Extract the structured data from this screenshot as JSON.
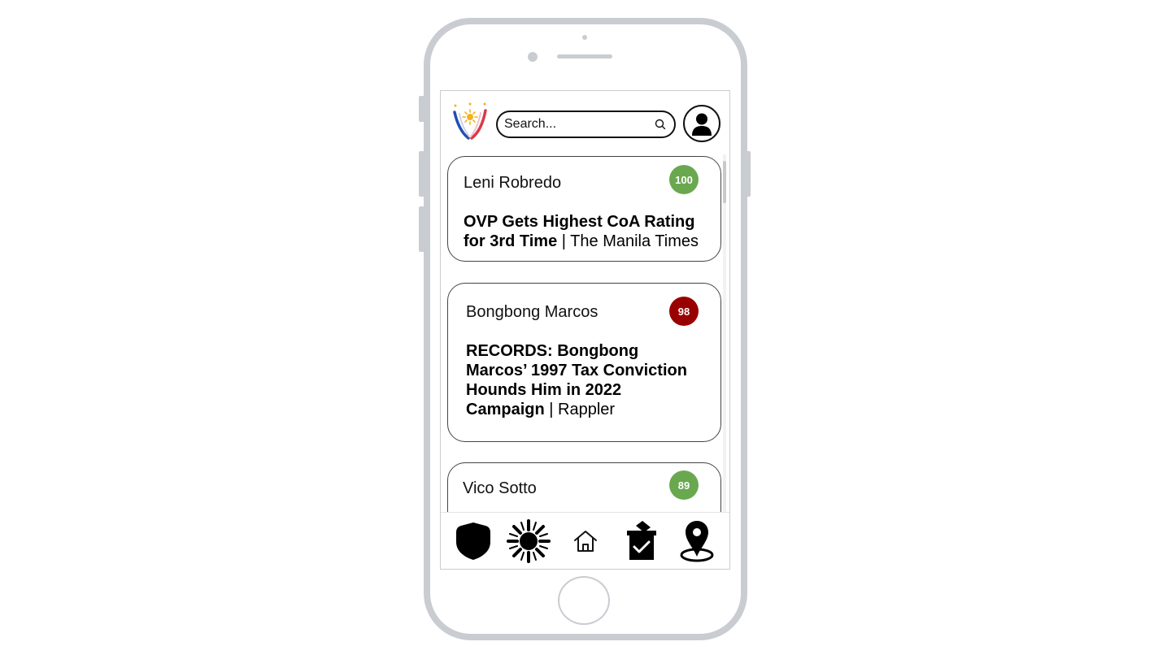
{
  "search": {
    "placeholder": "Search..."
  },
  "feed": [
    {
      "candidate": "Leni Robredo",
      "score": "100",
      "score_color": "#6aa84f",
      "headline": "OVP Gets Highest CoA Rating for 3rd Time",
      "separator": " | ",
      "source": "The Manila Times"
    },
    {
      "candidate": "Bongbong Marcos",
      "score": "98",
      "score_color": "#990000",
      "headline": "RECORDS: Bongbong Marcos’ 1997 Tax Conviction Hounds Him in 2022 Campaign",
      "separator": " | ",
      "source": "Rappler"
    },
    {
      "candidate": "Vico Sotto",
      "score": "89",
      "score_color": "#6aa84f"
    }
  ],
  "nav": [
    {
      "icon": "shield-icon"
    },
    {
      "icon": "sun-icon"
    },
    {
      "icon": "home-icon"
    },
    {
      "icon": "ballot-box-icon"
    },
    {
      "icon": "location-pin-icon"
    }
  ]
}
